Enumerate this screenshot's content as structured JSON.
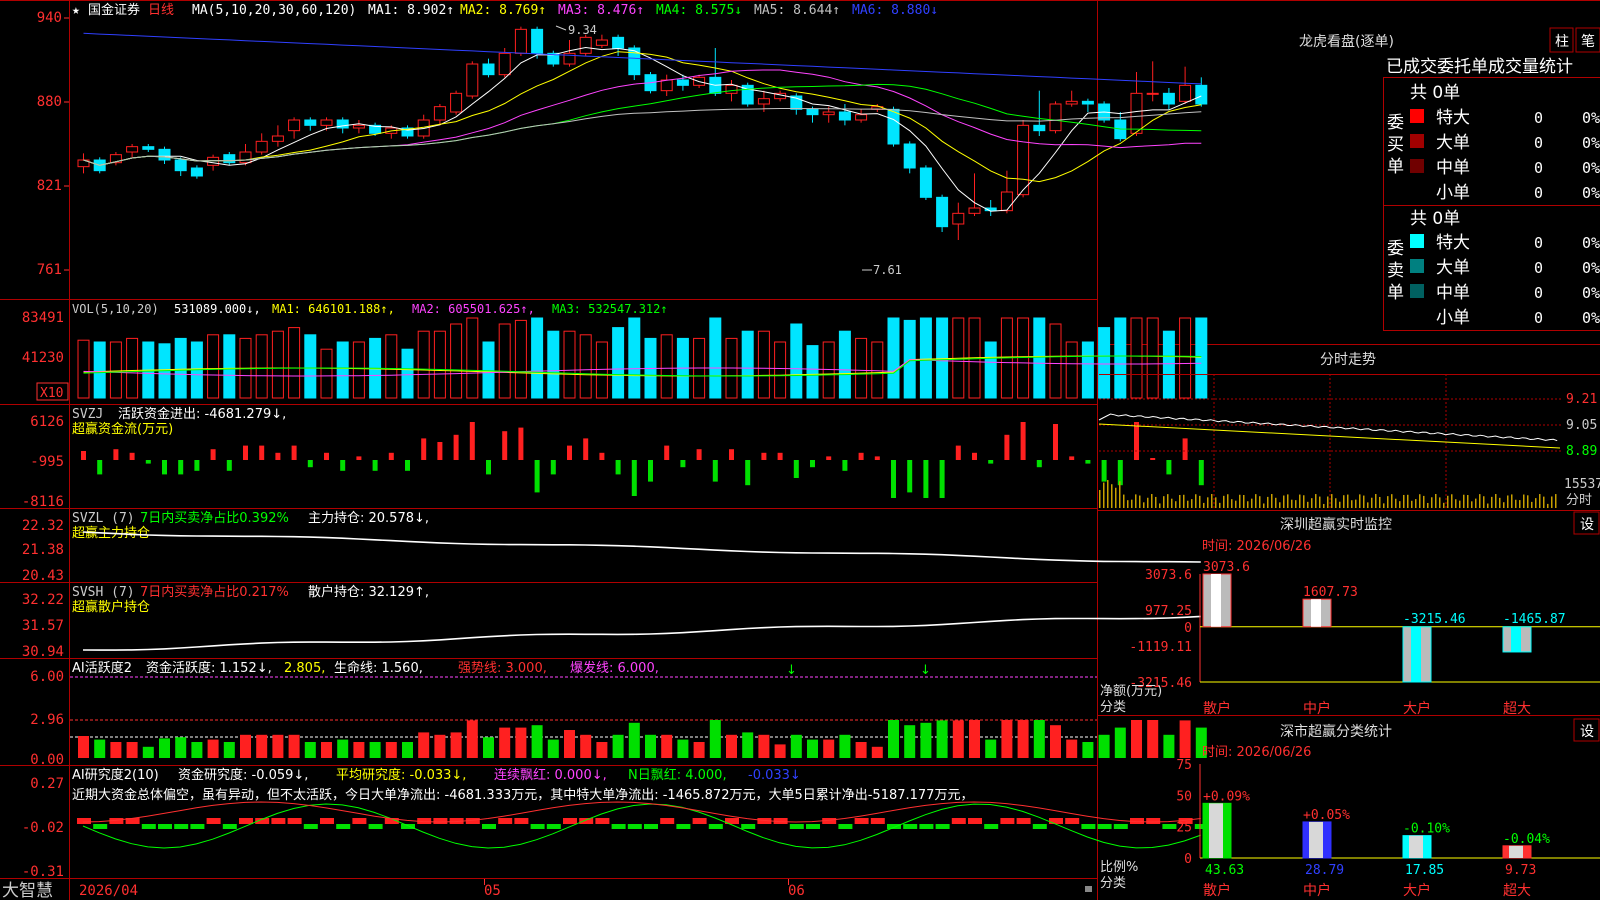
{
  "app": {
    "name": "大智慧",
    "stock_name": "国金证券",
    "period": "日线"
  },
  "colors": {
    "up": "#ff2020",
    "down": "#00e5ff",
    "grid": "#b00000",
    "ma1": "#ffffff",
    "ma2": "#ffff00",
    "ma3": "#ff44ff",
    "ma4": "#00ff00",
    "ma5": "#c0c0c0",
    "ma6": "#3040ff"
  },
  "main_panel": {
    "header": {
      "star": "★",
      "ma_label": "MA(5,10,20,30,60,120)",
      "ma1": "MA1: 8.902↑",
      "ma2": "MA2: 8.769↑",
      "ma3": "MA3: 8.476↑",
      "ma4": "MA4: 8.575↓",
      "ma5": "MA5: 8.644↑",
      "ma6": "MA6: 8.880↓"
    },
    "y_ticks": [
      "940",
      "880",
      "821",
      "761"
    ],
    "high_label": "9.34",
    "low_label": "7.61"
  },
  "vol_panel": {
    "header": {
      "label": "VOL(5,10,20)",
      "value": "531089.000↓,",
      "ma1": "MA1: 646101.188↑,",
      "ma2": "MA2: 605501.625↑,",
      "ma3": "MA3: 532547.312↑"
    },
    "y_ticks": [
      "83491",
      "41230"
    ],
    "unit": "X10"
  },
  "svzj_panel": {
    "header": {
      "label": "SVZJ",
      "title": "活跃资金进出: -4681.279↓,",
      "subtitle": "超赢资金流(万元)"
    },
    "y_ticks": [
      "6126",
      "-995",
      "-8116"
    ]
  },
  "svzl_panel": {
    "header": {
      "label": "SVZL (7)",
      "ratio": "7日内买卖净占比0.392%",
      "hold": "主力持仓: 20.578↓,",
      "subtitle": "超赢主力持仓"
    },
    "y_ticks": [
      "22.32",
      "21.38",
      "20.43"
    ]
  },
  "svsh_panel": {
    "header": {
      "label": "SVSH (7)",
      "ratio": "7日内买卖净占比0.217%",
      "hold": "散户持仓: 32.129↑,",
      "subtitle": "超赢散户持仓"
    },
    "y_ticks": [
      "32.22",
      "31.57",
      "30.94"
    ]
  },
  "ai_active_panel": {
    "header": {
      "label": "AI活跃度2",
      "v1": "资金活跃度: 1.152↓,",
      "v2": "2.805,",
      "v3": "生命线: 1.560,",
      "v4": "强势线: 3.000,",
      "v5": "爆发线: 6.000,"
    },
    "y_ticks": [
      "6.00",
      "2.96",
      "0.00"
    ]
  },
  "ai_research_panel": {
    "header": {
      "label": "AI研究度2(10)",
      "v1": "资金研究度: -0.059↓,",
      "v2": "平均研究度: -0.033↓,",
      "v3": "连续飘红: 0.000↓,",
      "v4": "N日飘红: 4.000,",
      "v5": "-0.033↓"
    },
    "comment": "近期大资金总体偏空，虽有异动，但不太活跃，今日大单净流出: -4681.333万元，其中特大单净流出: -1465.872万元，大单5日累计净出-5187.177万元，",
    "y_ticks": [
      "0.27",
      "-0.02",
      "-0.31"
    ]
  },
  "x_axis": {
    "labels": [
      "2026/04",
      "05",
      "06"
    ]
  },
  "longhu": {
    "title": "龙虎看盘(逐单)",
    "btn_zhu": "柱",
    "btn_bi": "笔",
    "tabs": [
      "已成交",
      "委托单",
      "成交量",
      "统计"
    ],
    "buy": {
      "side_label": "委买单",
      "total": "共 0单",
      "rows": [
        {
          "name": "特大",
          "count": "0",
          "pct": "0%",
          "color": "#ff0000"
        },
        {
          "name": "大单",
          "count": "0",
          "pct": "0%",
          "color": "#a00000"
        },
        {
          "name": "中单",
          "count": "0",
          "pct": "0%",
          "color": "#700000"
        },
        {
          "name": "小单",
          "count": "0",
          "pct": "0%",
          "color": ""
        }
      ]
    },
    "sell": {
      "side_label": "委卖单",
      "total": "共 0单",
      "rows": [
        {
          "name": "特大",
          "count": "0",
          "pct": "0%",
          "color": "#00ffff"
        },
        {
          "name": "大单",
          "count": "0",
          "pct": "0%",
          "color": "#008080"
        },
        {
          "name": "中单",
          "count": "0",
          "pct": "0%",
          "color": "#006060"
        },
        {
          "name": "小单",
          "count": "0",
          "pct": "0%",
          "color": ""
        }
      ]
    }
  },
  "intraday": {
    "title": "分时走势",
    "y_ticks": [
      "9.21",
      "9.05",
      "8.89"
    ],
    "vol_label": "15537",
    "unit_label": "分时"
  },
  "monitor": {
    "title": "深圳超赢实时监控",
    "btn": "设",
    "time": "时间: 2026/06/26",
    "y_ticks": [
      "3073.6",
      "977.25",
      "0",
      "-1119.11",
      "-3215.46"
    ],
    "ylabel": "净额(万元)",
    "xlabel": "分类"
  },
  "classify": {
    "title": "深市超赢分类统计",
    "btn": "设",
    "time": "时间: 2026/06/26",
    "y_ticks": [
      "75",
      "50",
      "25",
      "0"
    ],
    "ylabel": "比例%",
    "xlabel": "分类"
  },
  "chart_data": [
    {
      "type": "bar",
      "title": "深圳超赢实时监控",
      "categories": [
        "散户",
        "中户",
        "大户",
        "超大"
      ],
      "values": [
        3073.6,
        1607.73,
        -3215.46,
        -1465.87
      ],
      "value_labels": [
        "3073.6",
        "1607.73",
        "-3215.46",
        "-1465.87"
      ],
      "ylim": [
        -3215.46,
        3073.6
      ],
      "ylabel": "净额(万元)",
      "xlabel": "分类"
    },
    {
      "type": "bar",
      "title": "深市超赢分类统计",
      "categories": [
        "散户",
        "中户",
        "大户",
        "超大"
      ],
      "values": [
        43.63,
        28.79,
        17.85,
        9.73
      ],
      "changes": [
        "+0.09%",
        "+0.05%",
        "-0.10%",
        "-0.04%"
      ],
      "value_labels": [
        "43.63",
        "28.79",
        "17.85",
        "9.73"
      ],
      "ylim": [
        0,
        75
      ],
      "ylabel": "比例%",
      "xlabel": "分类"
    },
    {
      "type": "candlestick",
      "title": "国金证券 日线",
      "ylim": [
        7.5,
        9.45
      ],
      "candles": [
        [
          8.35,
          8.4,
          8.3,
          8.45
        ],
        [
          8.4,
          8.32,
          8.3,
          8.42
        ],
        [
          8.38,
          8.44,
          8.36,
          8.46
        ],
        [
          8.46,
          8.5,
          8.42,
          8.52
        ],
        [
          8.5,
          8.48,
          8.46,
          8.52
        ],
        [
          8.48,
          8.4,
          8.37,
          8.5
        ],
        [
          8.4,
          8.32,
          8.28,
          8.42
        ],
        [
          8.34,
          8.28,
          8.26,
          8.36
        ],
        [
          8.36,
          8.42,
          8.32,
          8.44
        ],
        [
          8.44,
          8.38,
          8.36,
          8.46
        ],
        [
          8.38,
          8.46,
          8.36,
          8.52
        ],
        [
          8.46,
          8.54,
          8.44,
          8.6
        ],
        [
          8.54,
          8.58,
          8.5,
          8.66
        ],
        [
          8.62,
          8.7,
          8.56,
          8.72
        ],
        [
          8.7,
          8.66,
          8.62,
          8.72
        ],
        [
          8.66,
          8.7,
          8.62,
          8.72
        ],
        [
          8.7,
          8.64,
          8.6,
          8.72
        ],
        [
          8.64,
          8.66,
          8.6,
          8.7
        ],
        [
          8.66,
          8.6,
          8.58,
          8.68
        ],
        [
          8.6,
          8.64,
          8.56,
          8.66
        ],
        [
          8.64,
          8.58,
          8.56,
          8.66
        ],
        [
          8.58,
          8.7,
          8.56,
          8.74
        ],
        [
          8.7,
          8.8,
          8.66,
          8.82
        ],
        [
          8.76,
          8.9,
          8.74,
          8.92
        ],
        [
          8.88,
          9.12,
          8.86,
          9.14
        ],
        [
          9.12,
          9.04,
          9.02,
          9.16
        ],
        [
          9.04,
          9.2,
          9.02,
          9.24
        ],
        [
          9.2,
          9.38,
          9.18,
          9.4
        ],
        [
          9.38,
          9.2,
          9.16,
          9.4
        ],
        [
          9.2,
          9.12,
          9.1,
          9.22
        ],
        [
          9.12,
          9.2,
          9.1,
          9.3
        ],
        [
          9.2,
          9.32,
          9.18,
          9.34
        ],
        [
          9.26,
          9.3,
          9.24,
          9.34
        ],
        [
          9.32,
          9.24,
          9.18,
          9.34
        ],
        [
          9.24,
          9.04,
          9.0,
          9.26
        ],
        [
          9.04,
          8.92,
          8.9,
          9.06
        ],
        [
          8.92,
          9.0,
          8.88,
          9.04
        ],
        [
          9.0,
          8.96,
          8.92,
          9.04
        ],
        [
          8.96,
          9.02,
          8.94,
          9.04
        ],
        [
          9.02,
          8.9,
          8.88,
          9.24
        ],
        [
          8.9,
          8.96,
          8.84,
          9.0
        ],
        [
          8.96,
          8.82,
          8.8,
          8.98
        ],
        [
          8.82,
          8.86,
          8.76,
          8.92
        ],
        [
          8.86,
          8.9,
          8.84,
          8.92
        ],
        [
          8.88,
          8.78,
          8.74,
          8.9
        ],
        [
          8.78,
          8.74,
          8.68,
          8.8
        ],
        [
          8.74,
          8.76,
          8.68,
          8.8
        ],
        [
          8.76,
          8.7,
          8.66,
          8.82
        ],
        [
          8.7,
          8.74,
          8.68,
          8.78
        ],
        [
          8.78,
          8.8,
          8.76,
          8.82
        ],
        [
          8.78,
          8.52,
          8.5,
          8.8
        ],
        [
          8.52,
          8.34,
          8.3,
          8.54
        ],
        [
          8.34,
          8.12,
          8.1,
          8.36
        ],
        [
          8.12,
          7.9,
          7.86,
          8.14
        ],
        [
          7.92,
          8.0,
          7.8,
          8.08
        ],
        [
          8.0,
          8.04,
          7.98,
          8.3
        ],
        [
          8.04,
          8.02,
          7.98,
          8.1
        ],
        [
          8.02,
          8.16,
          8.0,
          8.32
        ],
        [
          8.14,
          8.66,
          8.12,
          8.7
        ],
        [
          8.66,
          8.62,
          8.58,
          8.92
        ],
        [
          8.62,
          8.82,
          8.6,
          8.84
        ],
        [
          8.82,
          8.84,
          8.8,
          8.92
        ],
        [
          8.84,
          8.82,
          8.76,
          8.86
        ],
        [
          8.82,
          8.7,
          8.68,
          8.84
        ],
        [
          8.7,
          8.56,
          8.54,
          8.76
        ],
        [
          8.6,
          8.9,
          8.58,
          9.06
        ],
        [
          8.9,
          8.9,
          8.84,
          9.14
        ],
        [
          8.9,
          8.82,
          8.78,
          8.94
        ],
        [
          8.84,
          8.96,
          8.82,
          9.1
        ],
        [
          8.96,
          8.82,
          8.8,
          9.02
        ]
      ]
    }
  ]
}
